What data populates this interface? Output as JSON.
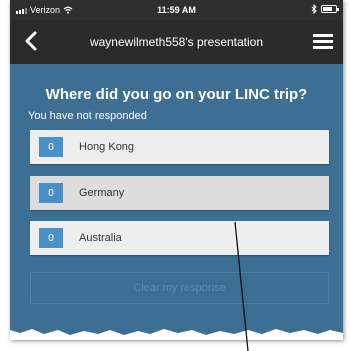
{
  "status_bar": {
    "carrier": "Verizon",
    "time": "11:59 AM"
  },
  "header": {
    "title": "waynewilmeth558's presentation"
  },
  "poll": {
    "question": "Where did you go on your LINC trip?",
    "response_status": "You have not responded",
    "options": [
      {
        "count": "0",
        "label": "Hong Kong"
      },
      {
        "count": "0",
        "label": "Germany"
      },
      {
        "count": "0",
        "label": "Australia"
      }
    ],
    "clear_label": "Clear my response"
  },
  "colors": {
    "background": "#3c6f93",
    "navbar": "#2b2b2b",
    "count_badge": "#4a90c8"
  },
  "icons": {
    "back": "chevron-left-icon",
    "menu": "hamburger-menu-icon",
    "wifi": "wifi-icon",
    "bluetooth": "bluetooth-icon",
    "battery": "battery-icon"
  }
}
